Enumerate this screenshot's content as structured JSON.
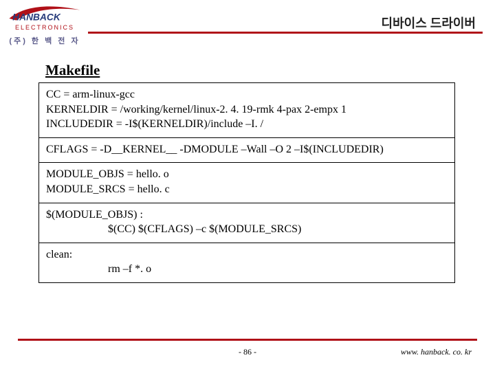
{
  "header": {
    "brand_word": "HANBACK",
    "brand_sub": "ELECTRONICS",
    "brand_kr": "(주) 한 백 전 자",
    "title": "디바이스 드라이버"
  },
  "section": {
    "title": "Makefile"
  },
  "code": {
    "block1": {
      "l1": "CC = arm-linux-gcc",
      "l2": "KERNELDIR = /working/kernel/linux-2. 4. 19-rmk 4-pax 2-empx 1",
      "l3": "INCLUDEDIR = -I$(KERNELDIR)/include –I. /"
    },
    "block2": {
      "l1": "CFLAGS = -D__KERNEL__  -DMODULE –Wall –O 2 –I$(INCLUDEDIR)"
    },
    "block3": {
      "l1": "MODULE_OBJS = hello. o",
      "l2": "MODULE_SRCS = hello. c"
    },
    "block4": {
      "l1": "$(MODULE_OBJS) :",
      "l2": "$(CC) $(CFLAGS) –c $(MODULE_SRCS)"
    },
    "block5": {
      "l1": "clean:",
      "l2": "rm –f *. o"
    }
  },
  "footer": {
    "page": "- 86 -",
    "url": "www. hanback. co. kr"
  }
}
